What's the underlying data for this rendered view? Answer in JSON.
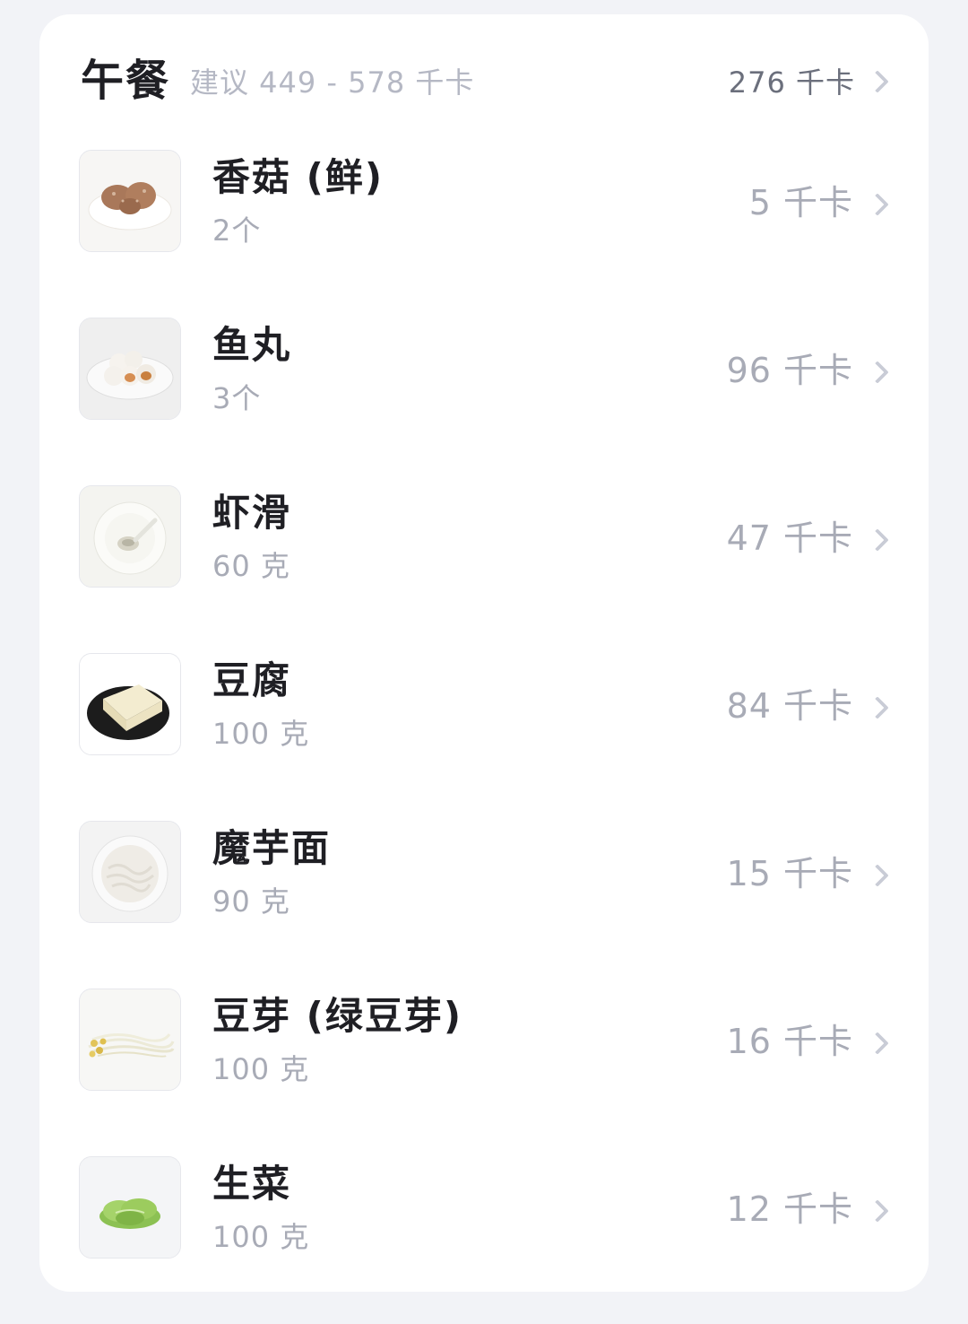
{
  "meal": {
    "title": "午餐",
    "suggestion": "建议 449 - 578 千卡",
    "total": "276 千卡"
  },
  "items": [
    {
      "name": "香菇 (鲜)",
      "quantity": "2个",
      "kcal": "5 千卡",
      "icon": "shiitake-mushroom-icon"
    },
    {
      "name": "鱼丸",
      "quantity": "3个",
      "kcal": "96 千卡",
      "icon": "fish-ball-icon"
    },
    {
      "name": "虾滑",
      "quantity": "60 克",
      "kcal": "47 千卡",
      "icon": "shrimp-paste-icon"
    },
    {
      "name": "豆腐",
      "quantity": "100 克",
      "kcal": "84 千卡",
      "icon": "tofu-icon"
    },
    {
      "name": "魔芋面",
      "quantity": "90 克",
      "kcal": "15 千卡",
      "icon": "konjac-noodles-icon"
    },
    {
      "name": "豆芽 (绿豆芽)",
      "quantity": "100 克",
      "kcal": "16 千卡",
      "icon": "bean-sprouts-icon"
    },
    {
      "name": "生菜",
      "quantity": "100 克",
      "kcal": "12 千卡",
      "icon": "lettuce-icon"
    }
  ],
  "colors": {
    "background": "#f2f3f7",
    "card": "#ffffff",
    "title_text": "#1f1f24",
    "muted_text": "#a8abb6"
  }
}
